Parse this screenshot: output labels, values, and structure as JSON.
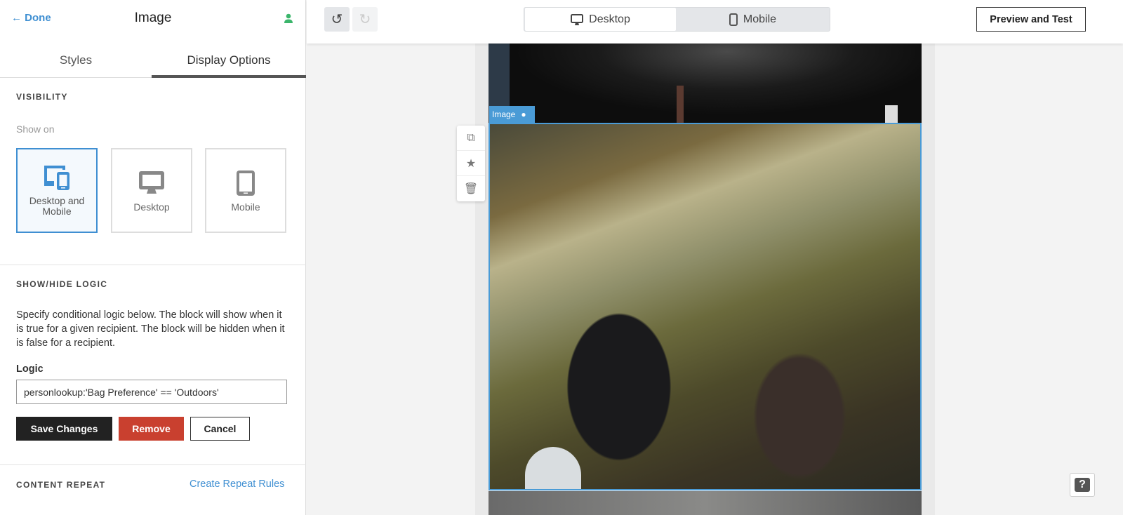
{
  "panel": {
    "done_label": "Done",
    "title": "Image",
    "tabs": [
      {
        "label": "Styles",
        "active": false
      },
      {
        "label": "Display Options",
        "active": true
      }
    ],
    "visibility": {
      "heading": "VISIBILITY",
      "show_on_label": "Show on",
      "options": [
        {
          "label": "Desktop and Mobile",
          "selected": true
        },
        {
          "label": "Desktop",
          "selected": false
        },
        {
          "label": "Mobile",
          "selected": false
        }
      ]
    },
    "logic_section": {
      "heading": "SHOW/HIDE LOGIC",
      "description": "Specify conditional logic below. The block will show when it is true for a given recipient. The block will be hidden when it is false for a recipient.",
      "logic_label": "Logic",
      "logic_value": "personlookup:'Bag Preference' == 'Outdoors'",
      "save_label": "Save Changes",
      "remove_label": "Remove",
      "cancel_label": "Cancel"
    },
    "content_repeat": {
      "heading": "CONTENT REPEAT",
      "link": "Create Repeat Rules"
    }
  },
  "toolbar": {
    "view_options": [
      {
        "label": "Desktop",
        "active": true
      },
      {
        "label": "Mobile",
        "active": false
      }
    ],
    "preview_label": "Preview and Test"
  },
  "canvas": {
    "selected_block_label": "Image"
  },
  "help_label": "?",
  "colors": {
    "accent": "#3f8fd2",
    "personalize": "#3bb56b",
    "danger": "#c9402f",
    "dark": "#222222"
  }
}
